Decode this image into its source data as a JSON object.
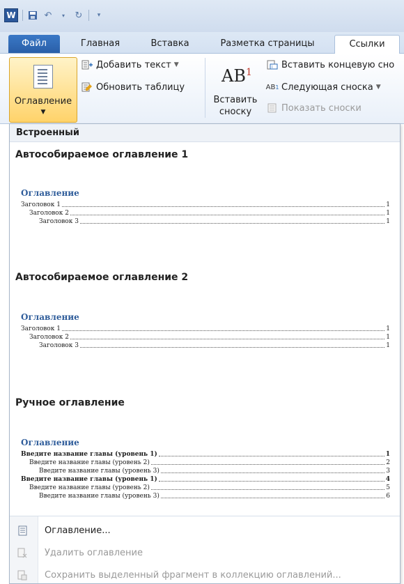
{
  "quick_access": {
    "logo": "W",
    "save_icon": "save-icon",
    "undo_icon": "undo-icon",
    "redo_icon": "redo-icon",
    "customize_icon": "customize-icon"
  },
  "tabs": [
    {
      "label": "Файл"
    },
    {
      "label": "Главная"
    },
    {
      "label": "Вставка"
    },
    {
      "label": "Разметка страницы"
    },
    {
      "label": "Ссылки"
    }
  ],
  "ribbon": {
    "toc_button": "Оглавление",
    "add_text": "Добавить текст",
    "update_table": "Обновить таблицу",
    "ab_glyph": "AB",
    "ab_sup": "1",
    "insert_footnote": "Вставить сноску",
    "insert_endnote": "Вставить концевую сно",
    "next_footnote": "Следующая сноска",
    "show_notes": "Показать сноски"
  },
  "dropdown": {
    "header": "Встроенный",
    "galleries": [
      {
        "name": "Автособираемое оглавление 1",
        "preview_title": "Оглавление",
        "lines": [
          {
            "text": "Заголовок 1",
            "page": "1",
            "level": 1
          },
          {
            "text": "Заголовок 2",
            "page": "1",
            "level": 2
          },
          {
            "text": "Заголовок 3",
            "page": "1",
            "level": 3
          }
        ]
      },
      {
        "name": "Автособираемое оглавление 2",
        "preview_title": "Оглавление",
        "lines": [
          {
            "text": "Заголовок 1",
            "page": "1",
            "level": 1
          },
          {
            "text": "Заголовок 2",
            "page": "1",
            "level": 2
          },
          {
            "text": "Заголовок 3",
            "page": "1",
            "level": 3
          }
        ]
      },
      {
        "name": "Ручное оглавление",
        "preview_title": "Оглавление",
        "lines": [
          {
            "text": "Введите название главы (уровень 1)",
            "page": "1",
            "level": 1
          },
          {
            "text": "Введите название главы (уровень 2)",
            "page": "2",
            "level": 2
          },
          {
            "text": "Введите название главы (уровень 3)",
            "page": "3",
            "level": 3
          },
          {
            "text": "Введите название главы (уровень 1)",
            "page": "4",
            "level": 1
          },
          {
            "text": "Введите название главы (уровень 2)",
            "page": "5",
            "level": 2
          },
          {
            "text": "Введите название главы (уровень 3)",
            "page": "6",
            "level": 3
          }
        ]
      }
    ],
    "commands": [
      {
        "label": "Оглавление...",
        "disabled": false
      },
      {
        "label": "Удалить оглавление",
        "disabled": true
      },
      {
        "label": "Сохранить выделенный фрагмент в коллекцию оглавлений...",
        "disabled": true
      }
    ]
  }
}
